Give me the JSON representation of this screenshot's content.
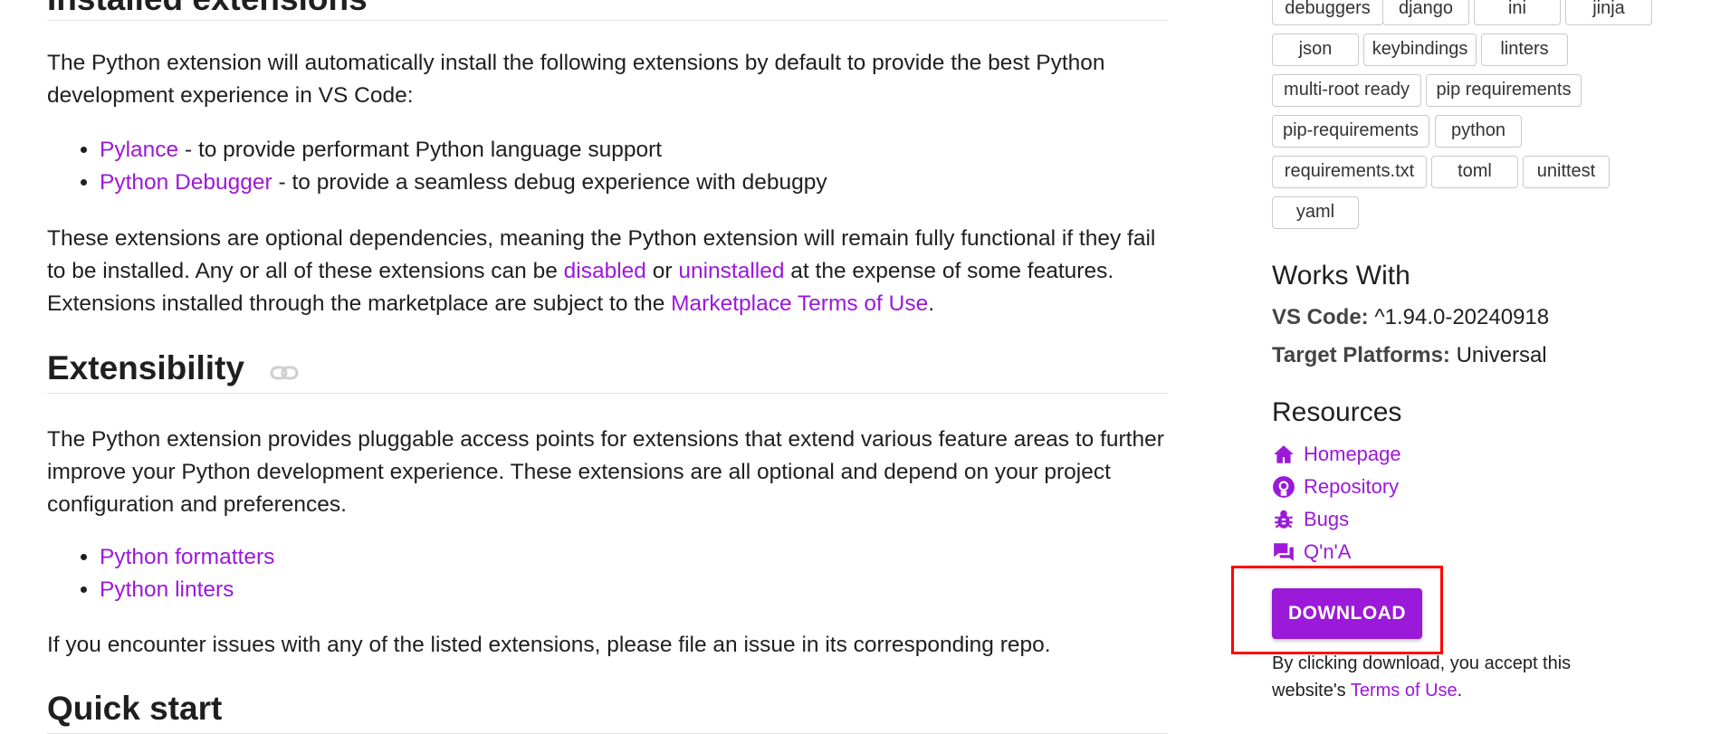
{
  "installed": {
    "heading": "Installed extensions",
    "intro": "The Python extension will automatically install the following extensions by default to provide the best Python development experience in VS Code:",
    "items": [
      {
        "link": "Pylance",
        "rest": " - to provide performant Python language support"
      },
      {
        "link": "Python Debugger",
        "rest": " - to provide a seamless debug experience with debugpy"
      }
    ],
    "para_a": "These extensions are optional dependencies, meaning the Python extension will remain fully functional if they fail to be installed. Any or all of these extensions can be ",
    "disabled": "disabled",
    "or": " or ",
    "uninstalled": "uninstalled",
    "para_b": " at the expense of some features. Extensions installed through the marketplace are subject to the ",
    "marketplace_terms": "Marketplace Terms of Use",
    "period": "."
  },
  "extensibility": {
    "heading": "Extensibility",
    "intro": "The Python extension provides pluggable access points for extensions that extend various feature areas to further improve your Python development experience. These extensions are all optional and depend on your project configuration and preferences.",
    "items": [
      "Python formatters",
      "Python linters"
    ],
    "outro": "If you encounter issues with any of the listed extensions, please file an issue in its corresponding repo."
  },
  "quickstart": {
    "heading": "Quick start"
  },
  "sidebar": {
    "tags": [
      "debuggers",
      "django",
      "ini",
      "jinja",
      "json",
      "keybindings",
      "linters",
      "multi-root ready",
      "pip requirements",
      "pip-requirements",
      "python",
      "requirements.txt",
      "toml",
      "unittest",
      "yaml"
    ],
    "works_with": {
      "heading": "Works With",
      "vscode_label": "VS Code:",
      "vscode_value": " ^1.94.0-20240918",
      "platforms_label": "Target Platforms:",
      "platforms_value": " Universal"
    },
    "resources": {
      "heading": "Resources",
      "items": [
        {
          "label": "Homepage",
          "icon": "home-icon"
        },
        {
          "label": "Repository",
          "icon": "github-icon"
        },
        {
          "label": "Bugs",
          "icon": "bug-icon"
        },
        {
          "label": "Q'n'A",
          "icon": "chat-icon"
        }
      ]
    },
    "download": {
      "label": "DOWNLOAD",
      "note_a": "By clicking download, you accept this website's ",
      "terms": "Terms of Use",
      "period": "."
    }
  },
  "colors": {
    "accent": "#9b19d8",
    "highlight": "#ff0000"
  }
}
